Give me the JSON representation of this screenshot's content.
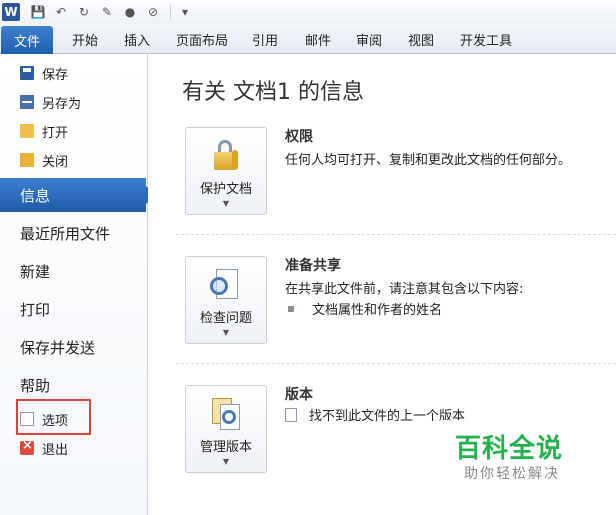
{
  "window": {
    "app_logo": "W"
  },
  "ribbon": {
    "tabs": [
      "文件",
      "开始",
      "插入",
      "页面布局",
      "引用",
      "邮件",
      "审阅",
      "视图",
      "开发工具"
    ]
  },
  "nav": {
    "small_items": [
      {
        "label": "保存",
        "icon": "save-icon"
      },
      {
        "label": "另存为",
        "icon": "save-as-icon"
      },
      {
        "label": "打开",
        "icon": "open-folder-icon"
      },
      {
        "label": "关闭",
        "icon": "close-folder-icon"
      }
    ],
    "active": "信息",
    "big_items": [
      "最近所用文件",
      "新建",
      "打印",
      "保存并发送",
      "帮助"
    ],
    "options_label": "选项",
    "exit_label": "退出"
  },
  "main": {
    "title": "有关 文档1 的信息",
    "sections": [
      {
        "button_label": "保护文档",
        "title": "权限",
        "description": "任何人均可打开、复制和更改此文档的任何部分。"
      },
      {
        "button_label": "检查问题",
        "title": "准备共享",
        "description": "在共享此文件前，请注意其包含以下内容:",
        "bullet": "文档属性和作者的姓名"
      },
      {
        "button_label": "管理版本",
        "title": "版本",
        "bullet": "找不到此文件的上一个版本"
      }
    ]
  },
  "watermark": {
    "brand": "百科全说",
    "tagline": "助你轻松解决"
  },
  "colors": {
    "file_tab": "#2a68b8",
    "highlight_box": "#e0413a",
    "watermark_green": "#23b14d"
  }
}
